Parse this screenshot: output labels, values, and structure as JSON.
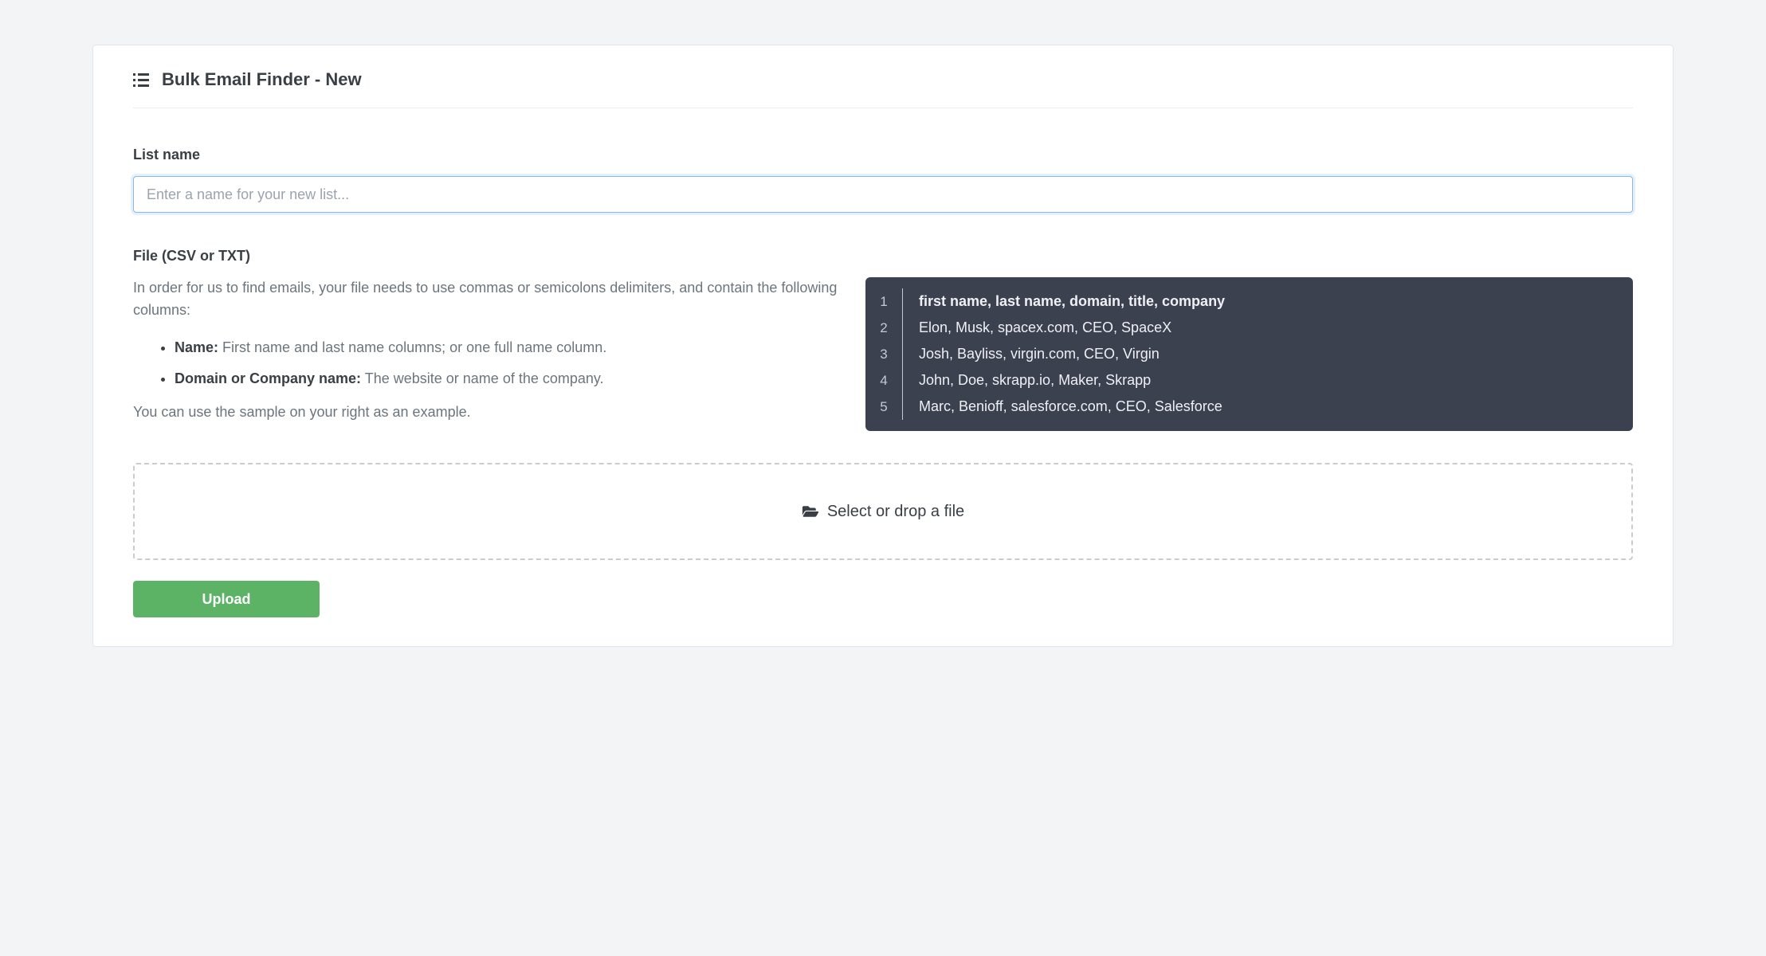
{
  "header": {
    "title": "Bulk Email Finder - New"
  },
  "form": {
    "list_name_label": "List name",
    "list_name_placeholder": "Enter a name for your new list...",
    "file_label": "File (CSV or TXT)",
    "helper_text": "In order for us to find emails, your file needs to use commas or semicolons delimiters, and contain the following columns:",
    "requirements": [
      {
        "label": "Name:",
        "desc": "First name and last name columns; or one full name column."
      },
      {
        "label": "Domain or Company name:",
        "desc": "The website or name of the company."
      }
    ],
    "example_footer": "You can use the sample on your right as an example.",
    "dropzone_label": "Select or drop a file",
    "upload_label": "Upload"
  },
  "sample": {
    "rows": [
      {
        "n": "1",
        "text": "first name, last name, domain, title, company",
        "header": true
      },
      {
        "n": "2",
        "text": "Elon, Musk, spacex.com, CEO, SpaceX",
        "header": false
      },
      {
        "n": "3",
        "text": "Josh, Bayliss, virgin.com, CEO, Virgin",
        "header": false
      },
      {
        "n": "4",
        "text": "John, Doe, skrapp.io, Maker, Skrapp",
        "header": false
      },
      {
        "n": "5",
        "text": "Marc, Benioff, salesforce.com, CEO, Salesforce",
        "header": false
      }
    ]
  }
}
